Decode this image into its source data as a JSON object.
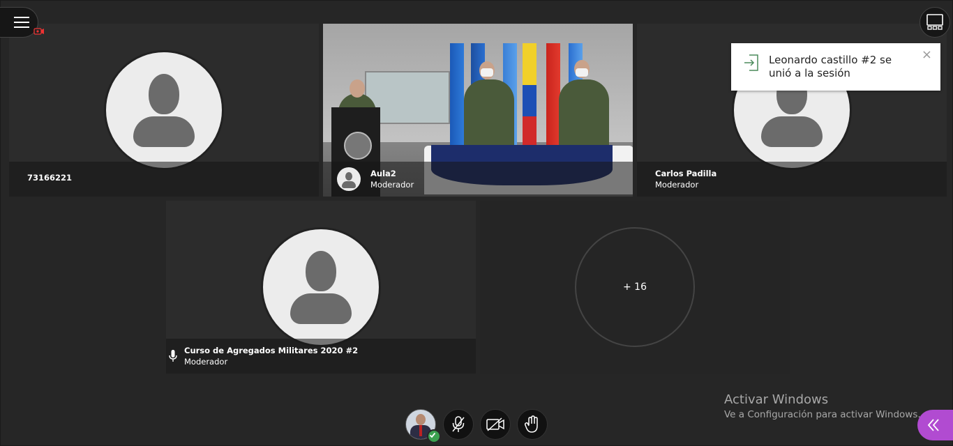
{
  "tiles": [
    {
      "name": "73166221",
      "role": ""
    },
    {
      "name": "Aula2",
      "role": "Moderador"
    },
    {
      "name": "Carlos Padilla",
      "role": "Moderador"
    },
    {
      "name": "Curso de Agregados Militares 2020 #2",
      "role": "Moderador"
    }
  ],
  "overflow": {
    "label": "+ 16"
  },
  "toast": {
    "message": "Leonardo castillo #2 se unió a la sesión",
    "close": "×"
  },
  "watermark": {
    "title": "Activar Windows",
    "subtitle": "Ve a Configuración para activar Windows."
  },
  "colors": {
    "background": "#262626",
    "tile": "#2c2c2c",
    "accent": "#b14bd1",
    "status_ok": "#3ca150"
  },
  "icons": {
    "menu": "hamburger-icon",
    "recording": "camera-recording-icon",
    "layout": "layout-grid-icon",
    "toast": "session-join-icon",
    "mic": "microphone-icon",
    "mic_off": "microphone-muted-icon",
    "camera_off": "camera-off-icon",
    "hand": "raise-hand-icon",
    "collapse": "double-chevron-left-icon"
  }
}
